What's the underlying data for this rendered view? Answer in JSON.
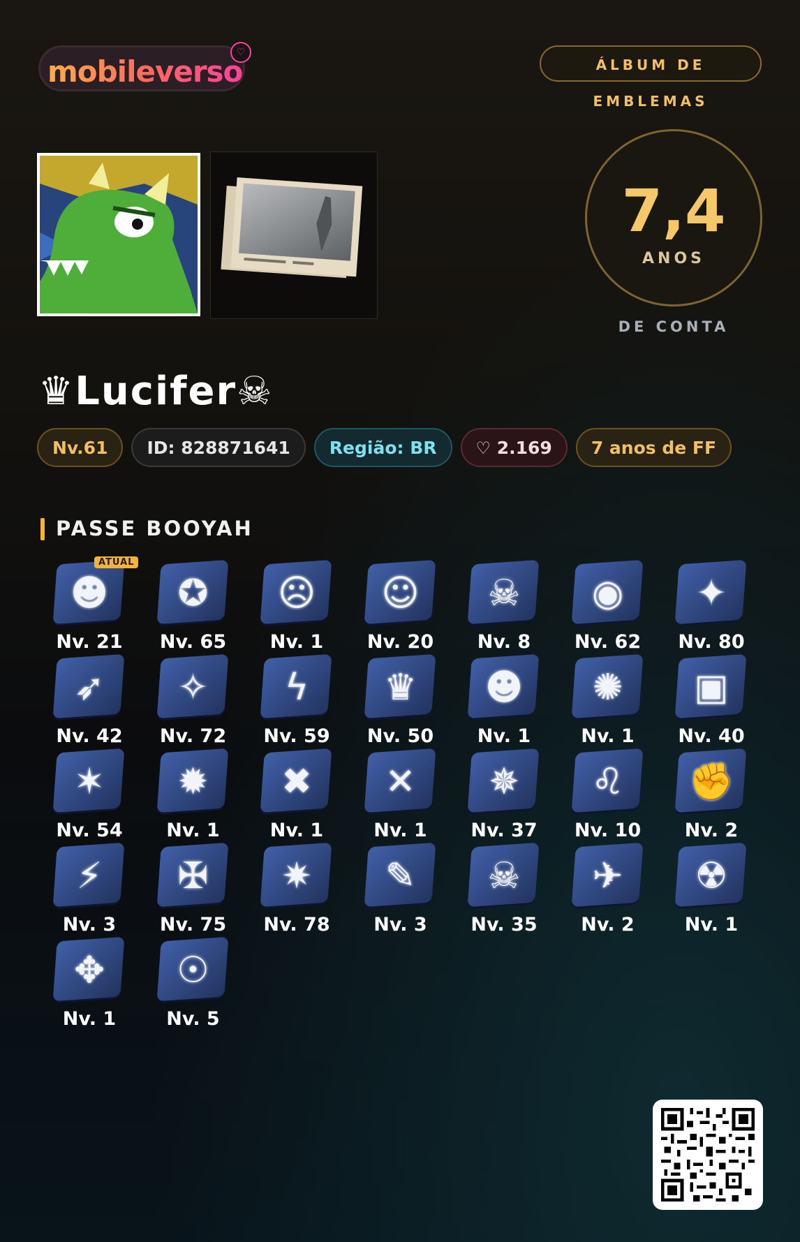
{
  "brand": {
    "name": "mobileverso"
  },
  "header": {
    "album_button": "ÁLBUM DE EMBLEMAS"
  },
  "account_age": {
    "value": "7,4",
    "unit": "ANOS",
    "label": "DE CONTA"
  },
  "player": {
    "name": "♛Lucifer☠",
    "chips": {
      "level": "Nv.61",
      "id": "ID: 828871641",
      "region": "Região: BR",
      "likes": "2.169",
      "years": "7 anos de FF"
    }
  },
  "section": {
    "title": "PASSE BOOYAH",
    "current_badge": "ATUAL"
  },
  "emblems": [
    {
      "level": "Nv. 21",
      "icon": "apple-emblem-icon"
    },
    {
      "level": "Nv. 65",
      "icon": "wolf-emblem-icon"
    },
    {
      "level": "Nv. 1",
      "icon": "face-emblem-icon"
    },
    {
      "level": "Nv. 20",
      "icon": "sunglasses-emblem-icon"
    },
    {
      "level": "Nv. 8",
      "icon": "skull-target-emblem-icon"
    },
    {
      "level": "Nv. 62",
      "icon": "ball-emblem-icon"
    },
    {
      "level": "Nv. 80",
      "icon": "fox-emblem-icon"
    },
    {
      "level": "Nv. 42",
      "icon": "bow-emblem-icon"
    },
    {
      "level": "Nv. 72",
      "icon": "ghost-emblem-icon"
    },
    {
      "level": "Nv. 59",
      "icon": "lightning-emblem-icon"
    },
    {
      "level": "Nv. 50",
      "icon": "crown-king-emblem-icon"
    },
    {
      "level": "Nv. 1",
      "icon": "devil-emblem-icon"
    },
    {
      "level": "Nv. 1",
      "icon": "bee-emblem-icon"
    },
    {
      "level": "Nv. 40",
      "icon": "robot-box-emblem-icon"
    },
    {
      "level": "Nv. 54",
      "icon": "splash-emblem-icon"
    },
    {
      "level": "Nv. 1",
      "icon": "creature-emblem-icon"
    },
    {
      "level": "Nv. 1",
      "icon": "xx-face-emblem-icon"
    },
    {
      "level": "Nv. 1",
      "icon": "ox-emblem-icon"
    },
    {
      "level": "Nv. 37",
      "icon": "octopus-emblem-icon"
    },
    {
      "level": "Nv. 10",
      "icon": "leo-emblem-icon"
    },
    {
      "level": "Nv. 2",
      "icon": "fighter-emblem-icon"
    },
    {
      "level": "Nv. 3",
      "icon": "claw-emblem-icon"
    },
    {
      "level": "Nv. 75",
      "icon": "warrior-emblem-icon"
    },
    {
      "level": "Nv. 78",
      "icon": "spiky-ball-emblem-icon"
    },
    {
      "level": "Nv. 3",
      "icon": "graffiti-emblem-icon"
    },
    {
      "level": "Nv. 35",
      "icon": "crowned-skull-emblem-icon"
    },
    {
      "level": "Nv. 2",
      "icon": "spray-emblem-icon"
    },
    {
      "level": "Nv. 1",
      "icon": "demon-emblem-icon"
    },
    {
      "level": "Nv. 1",
      "icon": "dragon-emblem-icon"
    },
    {
      "level": "Nv. 5",
      "icon": "helmet-emblem-icon"
    }
  ]
}
